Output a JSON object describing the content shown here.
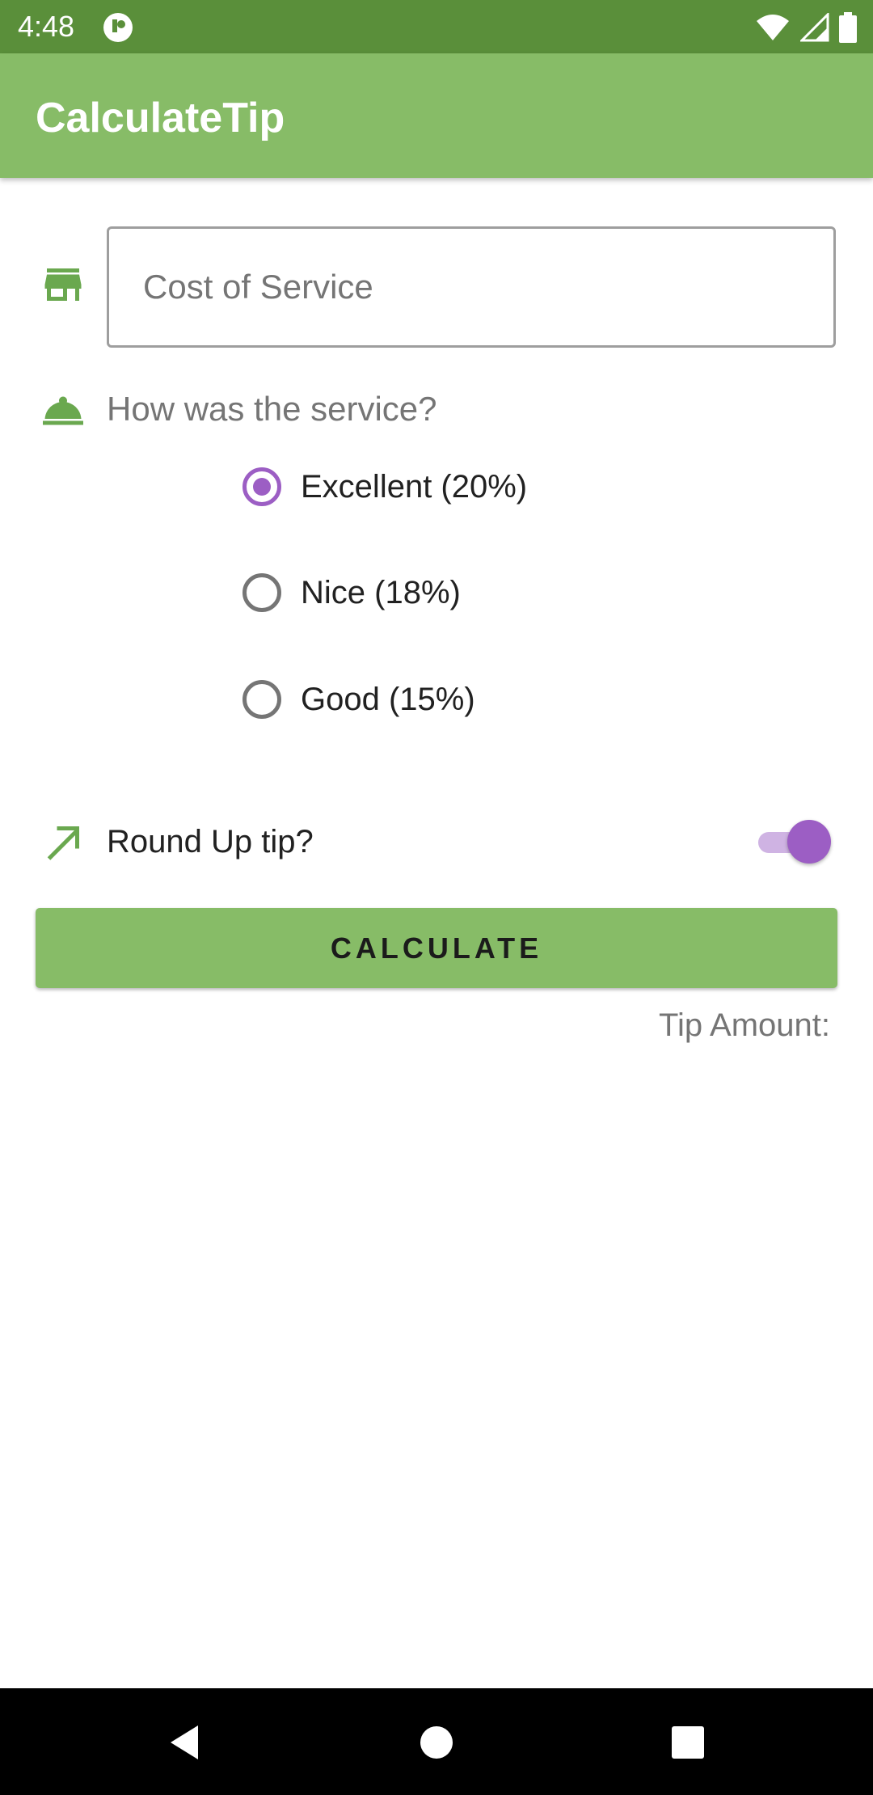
{
  "status_bar": {
    "time": "4:48",
    "icons": [
      "app-notification-icon",
      "wifi-icon",
      "signal-icon",
      "battery-icon"
    ]
  },
  "app_bar": {
    "title": "CalculateTip"
  },
  "cost_field": {
    "placeholder": "Cost of Service",
    "value": "",
    "icon": "store-icon"
  },
  "service": {
    "question": "How was the service?",
    "icon": "room-service-bell-icon",
    "options": [
      {
        "label": "Excellent (20%)",
        "selected": true
      },
      {
        "label": "Nice (18%)",
        "selected": false
      },
      {
        "label": "Good (15%)",
        "selected": false
      }
    ]
  },
  "round_up": {
    "label": "Round Up tip?",
    "enabled": true,
    "icon": "trending-up-arrow-icon"
  },
  "calculate_button": {
    "label": "CALCULATE"
  },
  "tip_result": {
    "label": "Tip Amount:"
  },
  "colors": {
    "status_bar": "#5a8f3a",
    "primary": "#87bc67",
    "accent": "#9c5ec4",
    "nav_bar": "#000000"
  },
  "nav_bar": {
    "buttons": [
      "back-icon",
      "home-icon",
      "recents-icon"
    ]
  }
}
